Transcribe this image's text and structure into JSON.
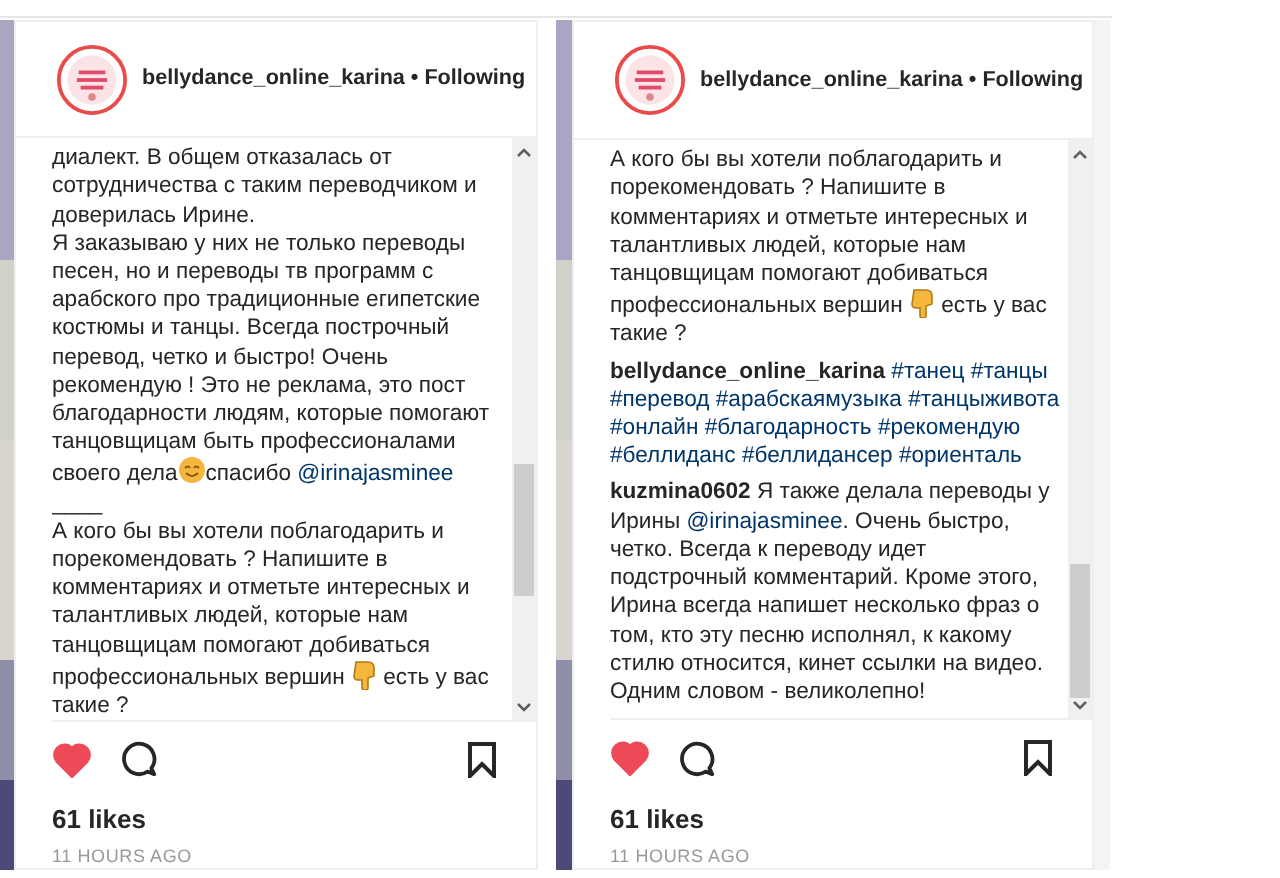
{
  "posts": [
    {
      "header": {
        "username": "bellydance_online_karina",
        "separator": "•",
        "follow": "Following"
      },
      "blocks": [
        {
          "kind": "para",
          "parts": [
            {
              "kind": "text",
              "text": "диалект. В общем отказалась от сотрудничества с таким переводчиком и доверилась Ирине."
            }
          ]
        },
        {
          "kind": "para",
          "parts": [
            {
              "kind": "text",
              "text": "Я заказываю у них не только переводы песен, но и переводы тв программ с арабского про традиционные египетские костюмы и танцы. Всегда построчный перевод, четко и быстро! Очень рекомендую ! Это не реклама, это пост благодарности людям, которые помогают танцовщицам быть профессионалами своего дела"
            },
            {
              "kind": "smile"
            },
            {
              "kind": "text",
              "text": "спасибо "
            },
            {
              "kind": "mention",
              "text": "@irinajasminee"
            }
          ]
        },
        {
          "kind": "para",
          "parts": [
            {
              "kind": "text",
              "text": "____"
            }
          ]
        },
        {
          "kind": "para",
          "parts": [
            {
              "kind": "text",
              "text": "А кого бы вы хотели поблагодарить и порекомендовать ? Напишите в комментариях и отметьте интересных и талантливых людей, которые нам танцовщицам помогают добиваться профессиональных вершин "
            },
            {
              "kind": "hand"
            },
            {
              "kind": "text",
              "text": " есть у вас такие ?"
            }
          ]
        }
      ],
      "liked": true,
      "likes": "61 likes",
      "time": "11 HOURS AGO"
    },
    {
      "header": {
        "username": "bellydance_online_karina",
        "separator": "•",
        "follow": "Following"
      },
      "blocks": [
        {
          "kind": "para",
          "parts": [
            {
              "kind": "text",
              "text": "А кого бы вы хотели поблагодарить и порекомендовать ? Напишите в комментариях и отметьте интересных и талантливых людей, которые нам танцовщицам помогают добиваться профессиональных вершин "
            },
            {
              "kind": "hand"
            },
            {
              "kind": "text",
              "text": " есть у вас такие ?"
            }
          ]
        },
        {
          "kind": "comment",
          "parts": [
            {
              "kind": "user",
              "text": "bellydance_online_karina"
            },
            {
              "kind": "tags",
              "tags": [
                "#танец",
                "#танцы",
                "#перевод",
                "#арабскаямузыка",
                "#танцыживота",
                "#онлайн",
                "#благодарность",
                "#рекомендую",
                "#беллиданс",
                "#беллидансер",
                "#ориенталь"
              ]
            }
          ]
        },
        {
          "kind": "comment",
          "parts": [
            {
              "kind": "user",
              "text": "kuzmina0602"
            },
            {
              "kind": "text",
              "text": " Я также делала переводы у Ирины "
            },
            {
              "kind": "mention",
              "text": "@irinajasminee"
            },
            {
              "kind": "text",
              "text": ". Очень быстро, четко. Всегда к переводу идет подстрочный комментарий. Кроме этого, Ирина всегда напишет несколько фраз о том, кто эту песню исполнял, к какому стилю относится, кинет ссылки на видео. Одним словом - великолепно!"
            }
          ]
        }
      ],
      "liked": true,
      "likes": "61 likes",
      "time": "11 HOURS AGO"
    }
  ]
}
